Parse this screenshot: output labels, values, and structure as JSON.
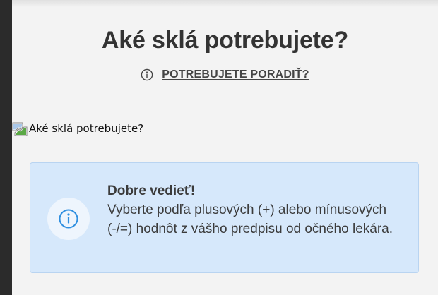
{
  "header": {
    "title": "Aké sklá potrebujete?",
    "advice_link_label": "POTREBUJETE PORADIŤ?",
    "advice_icon": "info-circle-icon"
  },
  "image": {
    "alt_text": "Aké sklá potrebujete?",
    "icon": "broken-image-icon"
  },
  "info_card": {
    "heading": "Dobre vedieť!",
    "body": "Vyberte podľa plusových (+) alebo mínusových (-/=) hodnôt z vášho predpisu od očného lekára.",
    "icon": "info-circle-icon"
  },
  "colors": {
    "background": "#f3f3f3",
    "card_background": "#d6e8fb",
    "card_border": "#b9d4f1",
    "accent_blue": "#2f8fe0",
    "text": "#333333"
  }
}
